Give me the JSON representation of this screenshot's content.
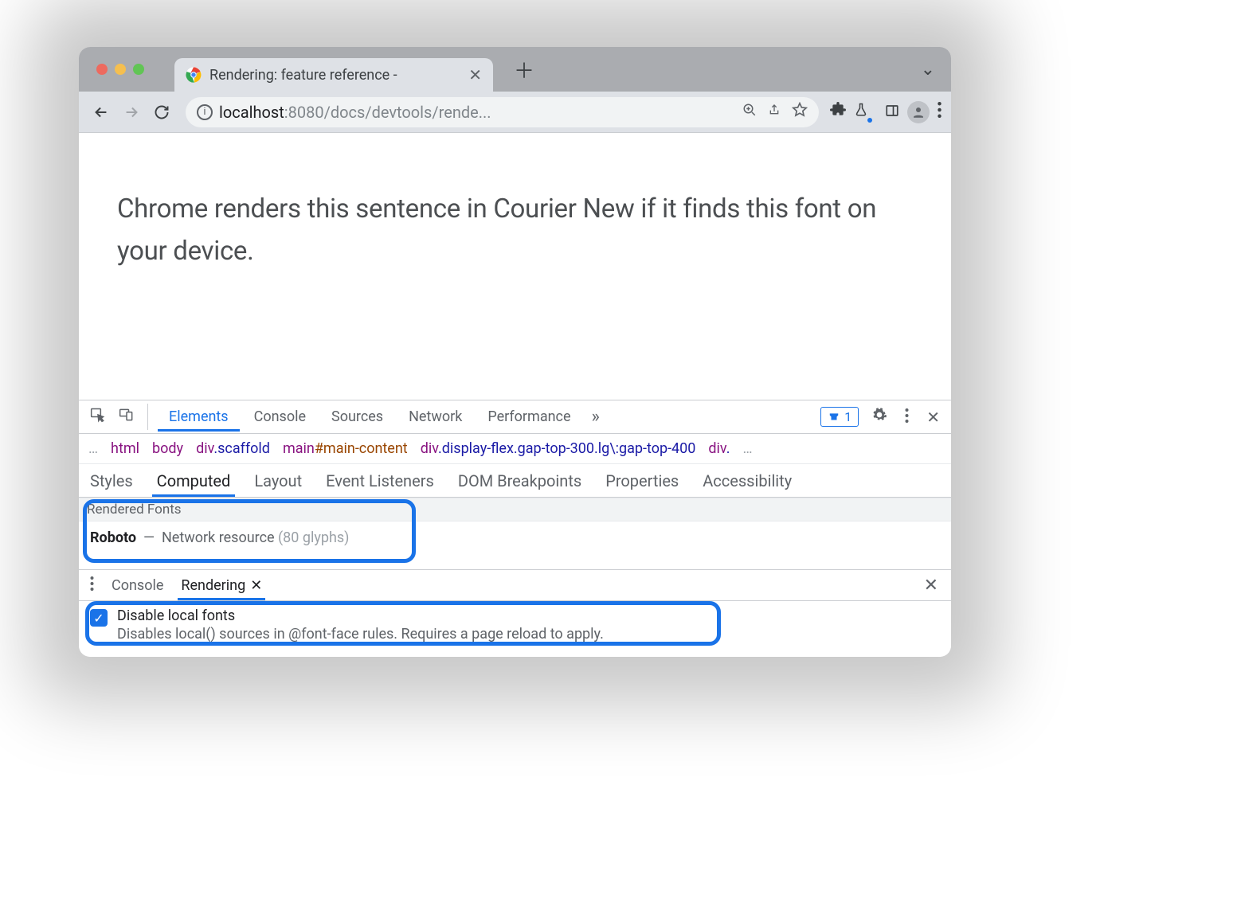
{
  "window": {
    "tab_title": "Rendering: feature reference -",
    "url_host": "localhost",
    "url_port": ":8080",
    "url_path": "/docs/devtools/rende..."
  },
  "page": {
    "sentence": "Chrome renders this sentence in Courier New if it finds this font on your device."
  },
  "devtools": {
    "tabs": [
      "Elements",
      "Console",
      "Sources",
      "Network",
      "Performance"
    ],
    "active_tab": "Elements",
    "issues_count": "1",
    "breadcrumb": [
      {
        "tag": "html"
      },
      {
        "tag": "body"
      },
      {
        "tag": "div",
        "cls": ".scaffold"
      },
      {
        "tag": "main",
        "id": "#main-content"
      },
      {
        "tag": "div",
        "cls": ".display-flex.gap-top-300.lg\\:gap-top-400"
      },
      {
        "tag": "div"
      }
    ],
    "side_tabs": [
      "Styles",
      "Computed",
      "Layout",
      "Event Listeners",
      "DOM Breakpoints",
      "Properties",
      "Accessibility"
    ],
    "active_side_tab": "Computed",
    "rendered_fonts": {
      "header": "Rendered Fonts",
      "font_name": "Roboto",
      "sep": "—",
      "source": "Network resource",
      "glyphs": "(80 glyphs)"
    },
    "drawer_tabs": [
      "Console",
      "Rendering"
    ],
    "active_drawer_tab": "Rendering",
    "disable_local_fonts": {
      "label": "Disable local fonts",
      "desc": "Disables local() sources in @font-face rules. Requires a page reload to apply."
    }
  }
}
